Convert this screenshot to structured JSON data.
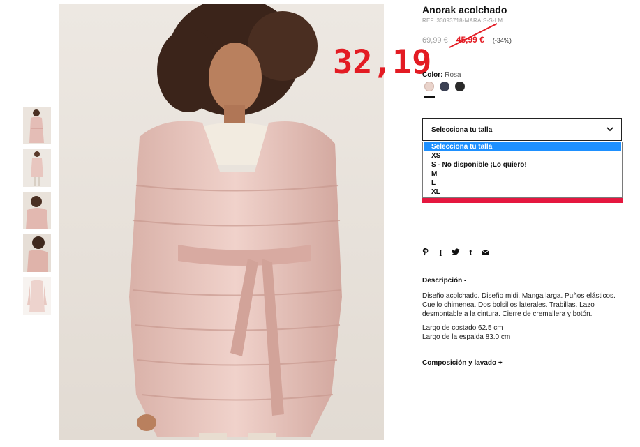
{
  "product": {
    "title": "Anorak acolchado",
    "ref": "REF. 33093718-MARAIS-S-LM",
    "old_price": "69,99 €",
    "sale_price": "45,99 €",
    "discount": "(-34%)",
    "annotation_price": "32,19",
    "color_label": "Color:",
    "color_value": "Rosa"
  },
  "colors": {
    "sale_red": "#e31b23",
    "select_highlight": "#1e90ff",
    "bar_red": "#e5173f"
  },
  "swatches": [
    {
      "name": "Rosa",
      "color": "#e9d3cb"
    },
    {
      "name": "Azul marino",
      "color": "#3a3f52"
    },
    {
      "name": "Negro",
      "color": "#2a2a2a"
    }
  ],
  "size_select": {
    "label": "Selecciona tu talla",
    "options": [
      "Selecciona tu talla",
      "XS",
      "S - No disponible ¡Lo quiero!",
      "M",
      "L",
      "XL"
    ]
  },
  "social": [
    {
      "icon": "pinterest-icon",
      "glyph": "𝓅"
    },
    {
      "icon": "facebook-icon",
      "glyph": "f"
    },
    {
      "icon": "twitter-icon",
      "glyph": "🐦"
    },
    {
      "icon": "tumblr-icon",
      "glyph": "t"
    },
    {
      "icon": "mail-icon",
      "glyph": "✉"
    }
  ],
  "description": {
    "heading": "Descripción -",
    "body": "Diseño acolchado. Diseño midi. Manga larga. Puños elásticos. Cuello chimenea. Dos bolsillos laterales. Trabillas. Lazo desmontable a la cintura. Cierre de cremallera y botón.",
    "measure_1": "Largo de costado 62.5 cm",
    "measure_2": "Largo de la espalda 83.0 cm"
  },
  "composition": {
    "heading": "Composición y lavado +"
  }
}
